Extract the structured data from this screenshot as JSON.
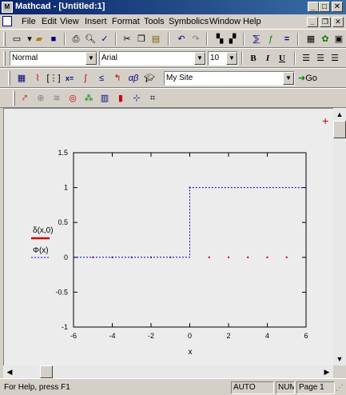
{
  "window": {
    "title": "Mathcad - [Untitled:1]",
    "app_icon_text": "M"
  },
  "menu": [
    "File",
    "Edit",
    "View",
    "Insert",
    "Format",
    "Tools",
    "Symbolics",
    "Window",
    "Help"
  ],
  "formatting": {
    "style": "Normal",
    "font": "Arial",
    "size": "10"
  },
  "resources": {
    "location": "My Site",
    "go_label": "Go"
  },
  "plot": {
    "legend": {
      "series1": "δ(x,0)",
      "series2": "Φ(x)"
    },
    "xlabel": "x",
    "xticks": [
      "-6",
      "-4",
      "-2",
      "0",
      "2",
      "4",
      "6"
    ],
    "yticks": [
      "1.5",
      "1",
      "0.5",
      "0",
      "-0.5",
      "-1"
    ]
  },
  "chart_data": {
    "type": "line",
    "xlabel": "x",
    "ylabel": "",
    "xlim": [
      -6,
      6
    ],
    "ylim": [
      -1,
      1.5
    ],
    "series": [
      {
        "name": "δ(x,0)",
        "color": "#cc0000",
        "style": "points",
        "x": [
          -5,
          -4,
          -3,
          -2,
          -1,
          0,
          1,
          2,
          3,
          4,
          5
        ],
        "y": [
          0,
          0,
          0,
          0,
          0,
          1,
          0,
          0,
          0,
          0,
          0
        ]
      },
      {
        "name": "Φ(x)",
        "color": "#0000cc",
        "style": "dashed-step",
        "x": [
          -6,
          0,
          0,
          6
        ],
        "y": [
          0,
          0,
          1,
          1
        ]
      }
    ]
  },
  "status": {
    "help": "For Help, press F1",
    "mode": "AUTO",
    "num": "NUM",
    "page": "Page 1"
  },
  "colors": {
    "titlebar": "#0a246a",
    "series1": "#cc0000",
    "series2": "#0000cc"
  }
}
